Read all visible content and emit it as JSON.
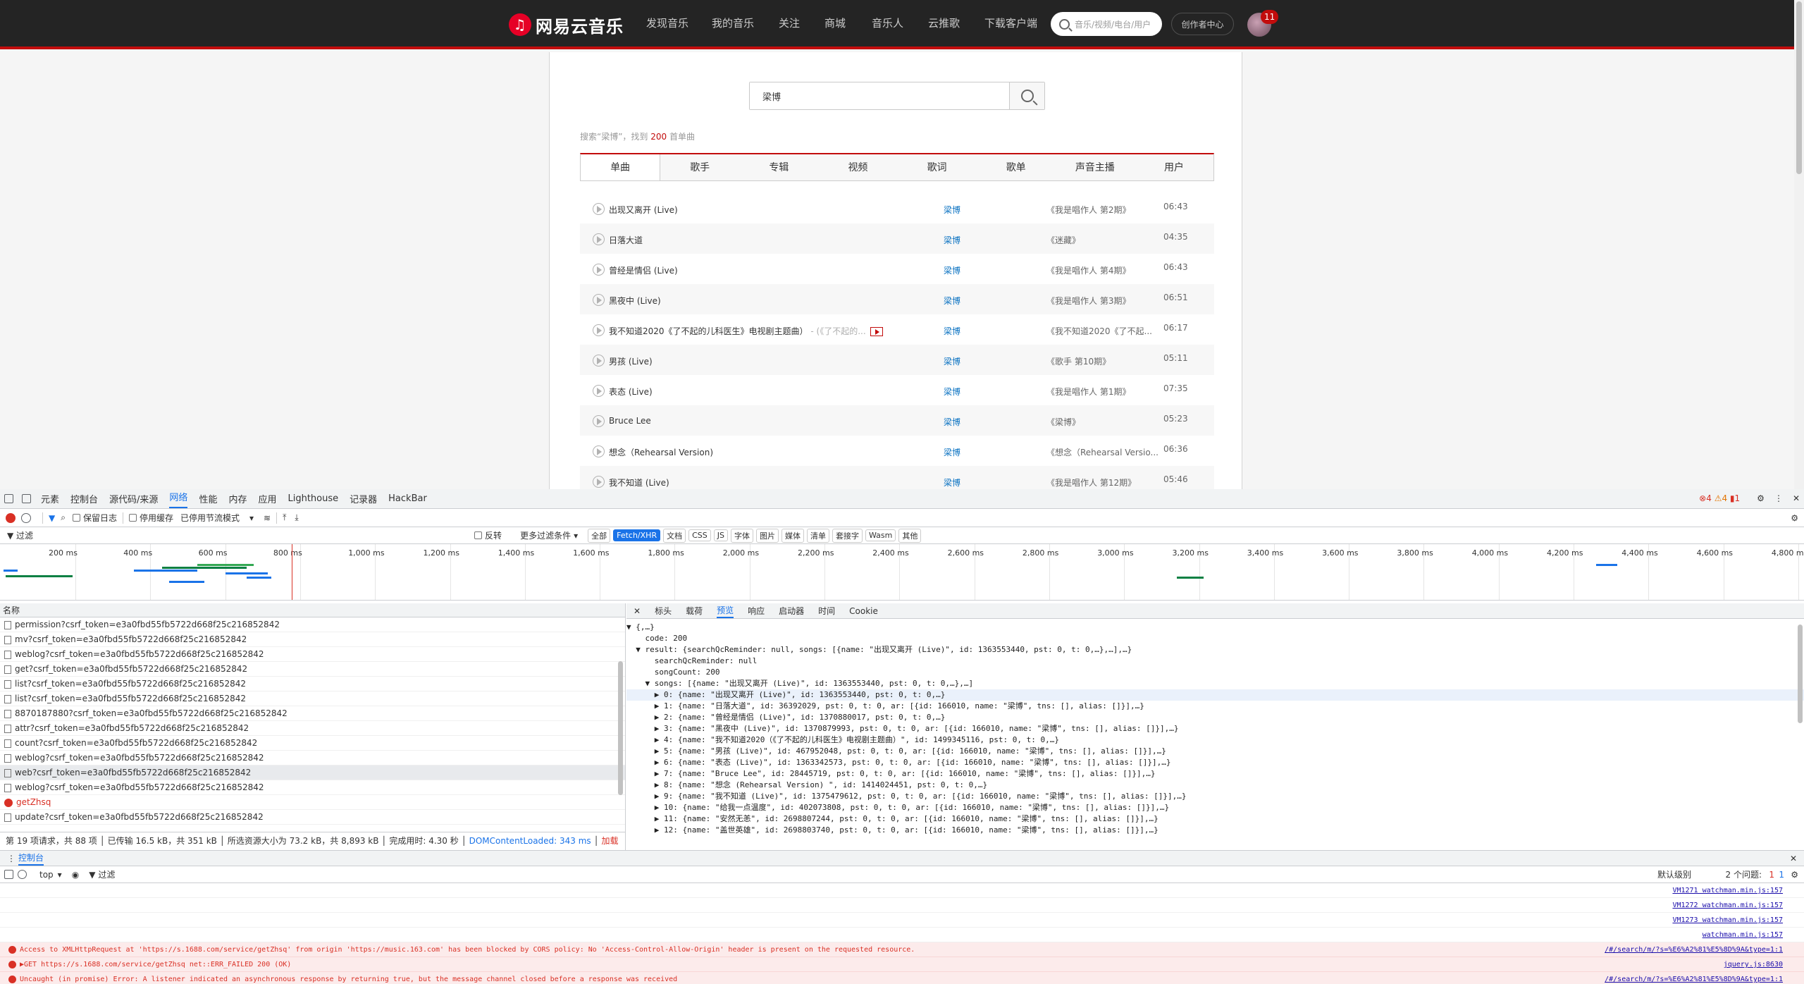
{
  "nav": {
    "logo_text": "网易云音乐",
    "items": [
      "发现音乐",
      "我的音乐",
      "关注",
      "商城",
      "音乐人",
      "云推歌",
      "下载客户端"
    ],
    "search_placeholder": "音乐/视频/电台/用户",
    "creator_button": "创作者中心",
    "message_count": "11"
  },
  "search": {
    "query": "梁博",
    "summary_prefix": "搜索“梁博”，找到 ",
    "summary_count": "200",
    "summary_suffix": " 首单曲"
  },
  "tabs": [
    "单曲",
    "歌手",
    "专辑",
    "视频",
    "歌词",
    "歌单",
    "声音主播",
    "用户"
  ],
  "songs": [
    {
      "title": "出现又离开 (Live)",
      "sub": "",
      "artist": "梁博",
      "album": "《我是唱作人 第2期》",
      "duration": "06:43"
    },
    {
      "title": "日落大道",
      "sub": "",
      "artist": "梁博",
      "album": "《迷藏》",
      "duration": "04:35"
    },
    {
      "title": "曾经是情侣 (Live)",
      "sub": "",
      "artist": "梁博",
      "album": "《我是唱作人 第4期》",
      "duration": "06:43"
    },
    {
      "title": "黑夜中 (Live)",
      "sub": "",
      "artist": "梁博",
      "album": "《我是唱作人 第3期》",
      "duration": "06:51"
    },
    {
      "title": "我不知道2020《了不起的儿科医生》电视剧主题曲）",
      "sub": " - (《了不起的...",
      "artist": "梁博",
      "album": "《我不知道2020《了不起...",
      "duration": "06:17"
    },
    {
      "title": "男孩 (Live)",
      "sub": "",
      "artist": "梁博",
      "album": "《歌手 第10期》",
      "duration": "05:11"
    },
    {
      "title": "表态 (Live)",
      "sub": "",
      "artist": "梁博",
      "album": "《我是唱作人 第1期》",
      "duration": "07:35"
    },
    {
      "title": "Bruce Lee",
      "sub": "",
      "artist": "梁博",
      "album": "《梁博》",
      "duration": "05:23"
    },
    {
      "title": "想念（Rehearsal Version)",
      "sub": "",
      "artist": "梁博",
      "album": "《想念（Rehearsal Versio...",
      "duration": "06:36"
    },
    {
      "title": "我不知道 (Live)",
      "sub": "",
      "artist": "梁博",
      "album": "《我是唱作人 第12期》",
      "duration": "05:46"
    }
  ],
  "devtools": {
    "tabs": [
      "元素",
      "控制台",
      "源代码/来源",
      "网络",
      "性能",
      "内存",
      "应用",
      "Lighthouse",
      "记录器",
      "HackBar"
    ],
    "active_tab": "网络",
    "errors": "4",
    "warnings": "4",
    "issues": "1",
    "toolbar": {
      "preserve_log": "保留日志",
      "disable_cache": "停用缓存",
      "throttle": "已停用节流模式"
    },
    "filter": {
      "placeholder": "过滤",
      "invert": "反转",
      "more": "更多过滤条件",
      "types": [
        "全部",
        "Fetch/XHR",
        "文档",
        "CSS",
        "JS",
        "字体",
        "图片",
        "媒体",
        "清单",
        "套接字",
        "Wasm",
        "其他"
      ],
      "active_type": "Fetch/XHR"
    },
    "timeline_ticks": [
      "200 ms",
      "400 ms",
      "600 ms",
      "800 ms",
      "1,000 ms",
      "1,200 ms",
      "1,400 ms",
      "1,600 ms",
      "1,800 ms",
      "2,000 ms",
      "2,200 ms",
      "2,400 ms",
      "2,600 ms",
      "2,800 ms",
      "3,000 ms",
      "3,200 ms",
      "3,400 ms",
      "3,600 ms",
      "3,800 ms",
      "4,000 ms",
      "4,200 ms",
      "4,400 ms",
      "4,600 ms",
      "4,800 ms"
    ],
    "name_header": "名称",
    "requests": [
      {
        "name": "permission?csrf_token=e3a0fbd55fb5722d668f25c216852842",
        "type": "file"
      },
      {
        "name": "mv?csrf_token=e3a0fbd55fb5722d668f25c216852842",
        "type": "file"
      },
      {
        "name": "weblog?csrf_token=e3a0fbd55fb5722d668f25c216852842",
        "type": "file"
      },
      {
        "name": "get?csrf_token=e3a0fbd55fb5722d668f25c216852842",
        "type": "file"
      },
      {
        "name": "list?csrf_token=e3a0fbd55fb5722d668f25c216852842",
        "type": "file"
      },
      {
        "name": "list?csrf_token=e3a0fbd55fb5722d668f25c216852842",
        "type": "file"
      },
      {
        "name": "8870187880?csrf_token=e3a0fbd55fb5722d668f25c216852842",
        "type": "file"
      },
      {
        "name": "attr?csrf_token=e3a0fbd55fb5722d668f25c216852842",
        "type": "file"
      },
      {
        "name": "count?csrf_token=e3a0fbd55fb5722d668f25c216852842",
        "type": "file"
      },
      {
        "name": "weblog?csrf_token=e3a0fbd55fb5722d668f25c216852842",
        "type": "file"
      },
      {
        "name": "web?csrf_token=e3a0fbd55fb5722d668f25c216852842",
        "type": "file",
        "selected": true
      },
      {
        "name": "weblog?csrf_token=e3a0fbd55fb5722d668f25c216852842",
        "type": "file"
      },
      {
        "name": "getZhsq",
        "type": "error"
      },
      {
        "name": "update?csrf_token=e3a0fbd55fb5722d668f25c216852842",
        "type": "file"
      }
    ],
    "status": {
      "requests": "第 19 项请求，共 88 项",
      "transferred": "已传输 16.5 kB，共 351 kB",
      "resources": "所选资源大小为 73.2 kB，共 8,893 kB",
      "finish": "完成用时: 4.30 秒",
      "dcl": "DOMContentLoaded: 343 ms",
      "load": "加载"
    },
    "detail_tabs": [
      "标头",
      "载荷",
      "预览",
      "响应",
      "启动器",
      "时间",
      "Cookie"
    ],
    "detail_active": "预览",
    "json_lines": [
      "▼ {,…}",
      "    code: 200",
      "  ▼ result: {searchQcReminder: null, songs: [{name: \"出现又离开 (Live)\", id: 1363553440, pst: 0, t: 0,…},…],…}",
      "      searchQcReminder: null",
      "      songCount: 200",
      "    ▼ songs: [{name: \"出现又离开 (Live)\", id: 1363553440, pst: 0, t: 0,…},…]",
      "      ▶ 0: {name: \"出现又离开 (Live)\", id: 1363553440, pst: 0, t: 0,…}",
      "      ▶ 1: {name: \"日落大道\", id: 36392029, pst: 0, t: 0, ar: [{id: 166010, name: \"梁博\", tns: [], alias: []}],…}",
      "      ▶ 2: {name: \"曾经是情侣 (Live)\", id: 1370880017, pst: 0, t: 0,…}",
      "      ▶ 3: {name: \"黑夜中 (Live)\", id: 1370879993, pst: 0, t: 0, ar: [{id: 166010, name: \"梁博\", tns: [], alias: []}],…}",
      "      ▶ 4: {name: \"我不知道2020（《了不起的儿科医生》电视剧主题曲）\", id: 1499345116, pst: 0, t: 0,…}",
      "      ▶ 5: {name: \"男孩 (Live)\", id: 467952048, pst: 0, t: 0, ar: [{id: 166010, name: \"梁博\", tns: [], alias: []}],…}",
      "      ▶ 6: {name: \"表态 (Live)\", id: 1363342573, pst: 0, t: 0, ar: [{id: 166010, name: \"梁博\", tns: [], alias: []}],…}",
      "      ▶ 7: {name: \"Bruce Lee\", id: 28445719, pst: 0, t: 0, ar: [{id: 166010, name: \"梁博\", tns: [], alias: []}],…}",
      "      ▶ 8: {name: \"想念 (Rehearsal Version) \", id: 1414024451, pst: 0, t: 0,…}",
      "      ▶ 9: {name: \"我不知道 (Live)\", id: 1375479612, pst: 0, t: 0, ar: [{id: 166010, name: \"梁博\", tns: [], alias: []}],…}",
      "      ▶ 10: {name: \"给我一点温度\", id: 402073808, pst: 0, t: 0, ar: [{id: 166010, name: \"梁博\", tns: [], alias: []}],…}",
      "      ▶ 11: {name: \"安然无恙\", id: 2698807244, pst: 0, t: 0, ar: [{id: 166010, name: \"梁博\", tns: [], alias: []}],…}",
      "      ▶ 12: {name: \"盖世英雄\", id: 2698803740, pst: 0, t: 0, ar: [{id: 166010, name: \"梁博\", tns: [], alias: []}],…}"
    ],
    "console": {
      "label": "控制台",
      "context": "top",
      "filter": "过滤",
      "level": "默认级别",
      "issues": "2 个问题:",
      "issue_err": "1",
      "issue_info": "1",
      "lines": [
        {
          "text": "",
          "src": "VM1271 watchman.min.js:157",
          "type": "log"
        },
        {
          "text": "",
          "src": "VM1272 watchman.min.js:157",
          "type": "log"
        },
        {
          "text": "",
          "src": "VM1273 watchman.min.js:157",
          "type": "log"
        },
        {
          "text": "",
          "src": "watchman.min.js:157",
          "type": "log"
        },
        {
          "text": "Access to XMLHttpRequest at 'https://s.1688.com/service/getZhsq' from origin 'https://music.163.com' has been blocked by CORS policy: No 'Access-Control-Allow-Origin' header is present on the requested resource.",
          "src": "/#/search/m/?s=%E6%A2%81%E5%8D%9A&type=1:1",
          "type": "error"
        },
        {
          "text": "▶GET https://s.1688.com/service/getZhsq net::ERR_FAILED 200 (OK)",
          "src": "jquery.js:8630",
          "type": "error"
        },
        {
          "text": "Uncaught (in promise) Error: A listener indicated an asynchronous response by returning true, but the message channel closed before a response was received",
          "src": "/#/search/m/?s=%E6%A2%81%E5%8D%9A&type=1:1",
          "type": "error"
        }
      ]
    }
  }
}
